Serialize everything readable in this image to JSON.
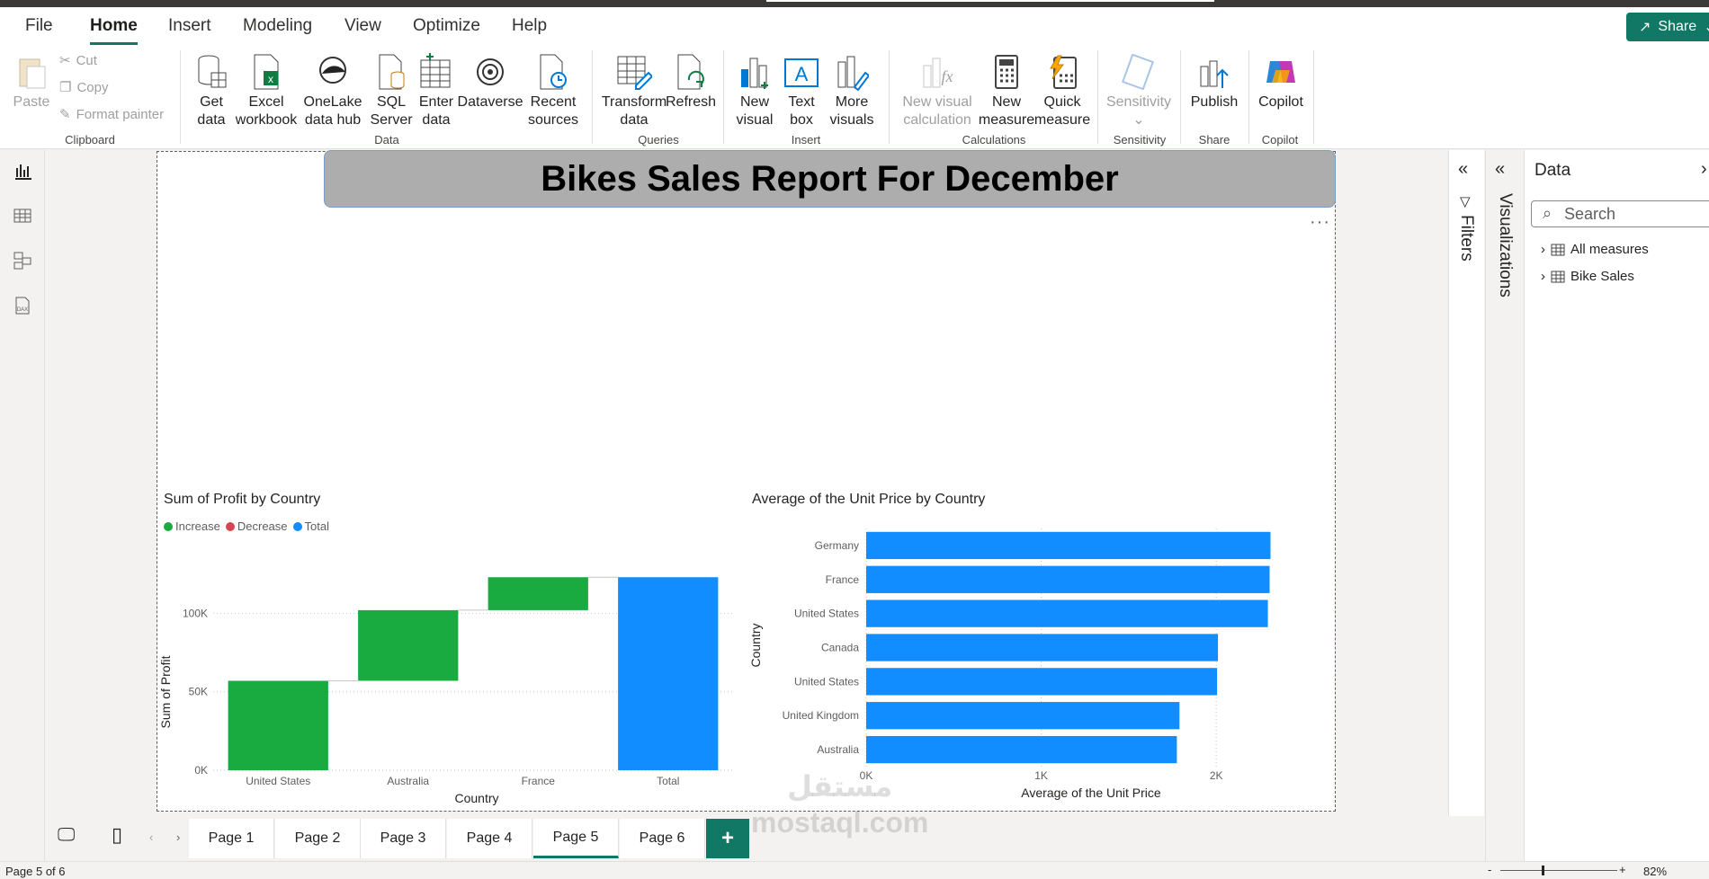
{
  "menu": {
    "items": [
      "File",
      "Home",
      "Insert",
      "Modeling",
      "View",
      "Optimize",
      "Help"
    ],
    "active": "Home",
    "share_label": "Share"
  },
  "ribbon": {
    "clipboard": {
      "paste": "Paste",
      "cut": "Cut",
      "copy": "Copy",
      "format_painter": "Format painter",
      "label": "Clipboard"
    },
    "data": {
      "get_data": [
        "Get",
        "data"
      ],
      "excel": [
        "Excel",
        "workbook"
      ],
      "onelake": [
        "OneLake",
        "data hub"
      ],
      "sql": [
        "SQL",
        "Server"
      ],
      "enter": [
        "Enter",
        "data"
      ],
      "dataverse": [
        "Dataverse",
        ""
      ],
      "recent": [
        "Recent",
        "sources"
      ],
      "label": "Data"
    },
    "queries": {
      "transform": [
        "Transform",
        "data"
      ],
      "refresh": [
        "Refresh",
        ""
      ],
      "label": "Queries"
    },
    "insert": {
      "new_visual": [
        "New",
        "visual"
      ],
      "text_box": [
        "Text",
        "box"
      ],
      "more_visuals": [
        "More",
        "visuals"
      ],
      "label": "Insert"
    },
    "calculations": {
      "new_visual_calc": [
        "New visual",
        "calculation"
      ],
      "new_measure": [
        "New",
        "measure"
      ],
      "quick_measure": [
        "Quick",
        "measure"
      ],
      "label": "Calculations"
    },
    "sensitivity": {
      "btn": [
        "Sensitivity",
        ""
      ],
      "label": "Sensitivity"
    },
    "share": {
      "publish": [
        "Publish",
        ""
      ],
      "label": "Share"
    },
    "copilot": {
      "btn": [
        "Copilot",
        ""
      ],
      "label": "Copilot"
    }
  },
  "report": {
    "title": "Bikes Sales Report For December",
    "more": "···"
  },
  "waterfall": {
    "title": "Sum of Profit by Country",
    "legend": [
      "Increase",
      "Decrease",
      "Total"
    ],
    "colors": {
      "increase": "#1aab40",
      "decrease": "#d64550",
      "total": "#118dff"
    },
    "chart_data": {
      "type": "bar",
      "subtype": "waterfall",
      "categories": [
        "United States",
        "Australia",
        "France",
        "Total"
      ],
      "values": [
        57000,
        45000,
        21000,
        123000
      ],
      "ylabel": "Sum of Profit",
      "xlabel": "Country",
      "yticks": [
        "0K",
        "50K",
        "100K"
      ],
      "ylim": [
        0,
        130000
      ]
    }
  },
  "barchart": {
    "title": "Average of the Unit Price by Country",
    "color": "#118dff",
    "chart_data": {
      "type": "bar",
      "orientation": "horizontal",
      "categories": [
        "Germany",
        "France",
        "United States",
        "Canada",
        "United States",
        "United Kingdom",
        "Australia"
      ],
      "values": [
        2310,
        2305,
        2295,
        2010,
        2005,
        1790,
        1775
      ],
      "xlabel": "Average of the Unit Price",
      "ylabel": "Country",
      "xticks": [
        "0K",
        "1K",
        "2K"
      ],
      "xlim": [
        0,
        2400
      ]
    }
  },
  "panes": {
    "filters": "Filters",
    "visualizations": "Visualizations",
    "data_title": "Data",
    "search_placeholder": "Search",
    "tree": [
      "All measures",
      "Bike Sales"
    ]
  },
  "tabs": [
    "Page 1",
    "Page 2",
    "Page 3",
    "Page 4",
    "Page 5",
    "Page 6"
  ],
  "active_tab": "Page 5",
  "status": {
    "page": "Page 5 of 6",
    "zoom": "82%"
  },
  "watermark": [
    "مستقل",
    "mostaql.com"
  ]
}
